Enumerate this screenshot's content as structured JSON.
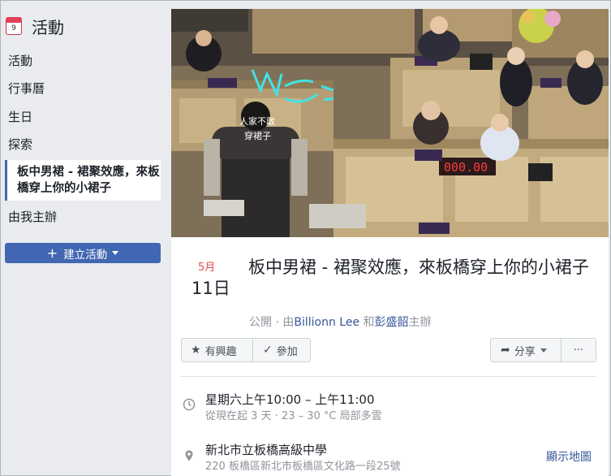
{
  "sidebar": {
    "title": "活動",
    "calendar_day": "9",
    "items": [
      "活動",
      "行事曆",
      "生日",
      "探索"
    ],
    "active_item": "板中男裙 - 裙聚效應，來板橋穿上你的小裙子",
    "hosting": "由我主辦",
    "create_button": "建立活動"
  },
  "cover": {
    "vest_text_line1": "人家不敢",
    "vest_text_line2": "穿裙子",
    "counter": "000.00"
  },
  "event": {
    "month": "5月",
    "day": "11日",
    "title": "板中男裙 - 裙聚效應，來板橋穿上你的小裙子",
    "visibility": "公開",
    "by": "由",
    "host1": "Billionn Lee",
    "and": "和",
    "host2": "彭盛韶",
    "hosting_suffix": "主辦"
  },
  "actions": {
    "interested": "有興趣",
    "going": "參加",
    "share": "分享",
    "more": "···"
  },
  "details": {
    "time": "星期六上午10:00 – 上午11:00",
    "time_sub": "從現在起 3 天 · 23 – 30 °C 局部多雲",
    "location": "新北市立板橋高級中學",
    "address": "220 板橋區新北市板橋區文化路一段25號",
    "show_map": "顯示地圖"
  },
  "colors": {
    "accent": "#4267b2",
    "link": "#365899",
    "month_red": "#e34c4c"
  }
}
